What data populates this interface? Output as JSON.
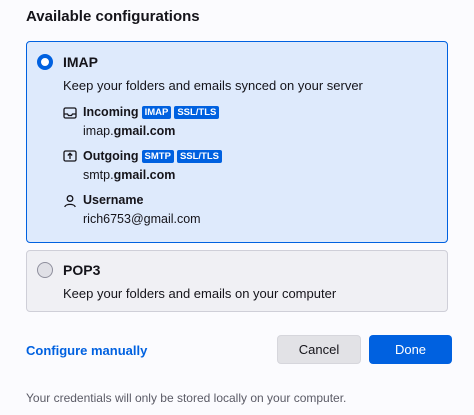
{
  "heading": "Available configurations",
  "imap": {
    "name": "IMAP",
    "description": "Keep your folders and emails synced on your server",
    "incoming": {
      "label": "Incoming",
      "badges": [
        "IMAP",
        "SSL/TLS"
      ],
      "host_prefix": "imap.",
      "host_bold": "gmail.com"
    },
    "outgoing": {
      "label": "Outgoing",
      "badges": [
        "SMTP",
        "SSL/TLS"
      ],
      "host_prefix": "smtp.",
      "host_bold": "gmail.com"
    },
    "username": {
      "label": "Username",
      "value": "rich6753@gmail.com"
    },
    "selected": true
  },
  "pop3": {
    "name": "POP3",
    "description": "Keep your folders and emails on your computer",
    "selected": false
  },
  "actions": {
    "configure_manually": "Configure manually",
    "cancel": "Cancel",
    "done": "Done"
  },
  "footnote": "Your credentials will only be stored locally on your computer.",
  "colors": {
    "accent": "#0061e0",
    "selected_bg": "#deeafc"
  }
}
